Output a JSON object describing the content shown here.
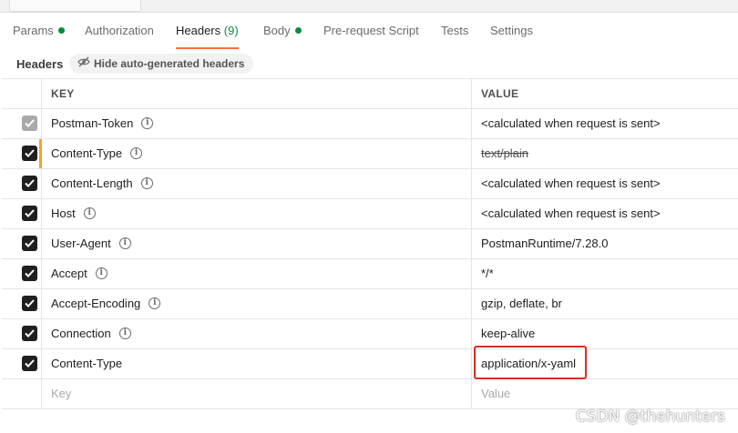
{
  "tabs": [
    {
      "label": "Params",
      "has_dot": true
    },
    {
      "label": "Authorization"
    },
    {
      "label": "Headers",
      "count": "(9)",
      "active": true
    },
    {
      "label": "Body",
      "has_dot": true
    },
    {
      "label": "Pre-request Script"
    },
    {
      "label": "Tests"
    },
    {
      "label": "Settings"
    }
  ],
  "headers_section": {
    "title": "Headers",
    "hide_button_label": "Hide auto-generated headers"
  },
  "table": {
    "columns": {
      "key": "KEY",
      "value": "VALUE"
    },
    "rows": [
      {
        "key": "Postman-Token",
        "value": "<calculated when request is sent>"
      },
      {
        "key": "Content-Type",
        "value": "text/plain"
      },
      {
        "key": "Content-Length",
        "value": "<calculated when request is sent>"
      },
      {
        "key": "Host",
        "value": "<calculated when request is sent>"
      },
      {
        "key": "User-Agent",
        "value": "PostmanRuntime/7.28.0"
      },
      {
        "key": "Accept",
        "value": "*/*"
      },
      {
        "key": "Accept-Encoding",
        "value": "gzip, deflate, br"
      },
      {
        "key": "Connection",
        "value": "keep-alive"
      },
      {
        "key": "Content-Type",
        "value": "application/x-yaml"
      }
    ],
    "new_row": {
      "key_placeholder": "Key",
      "value_placeholder": "Value"
    }
  },
  "watermark": "CSDN @thehunters",
  "colors": {
    "active_tab_underline": "#ff6c37",
    "dot": "#0b8a3e",
    "highlight": "#e02b20",
    "focus_bar": "#f5a623"
  },
  "icons": {
    "info": "info-circle-icon",
    "hide": "eye-slash-icon",
    "check": "checkmark-icon"
  }
}
